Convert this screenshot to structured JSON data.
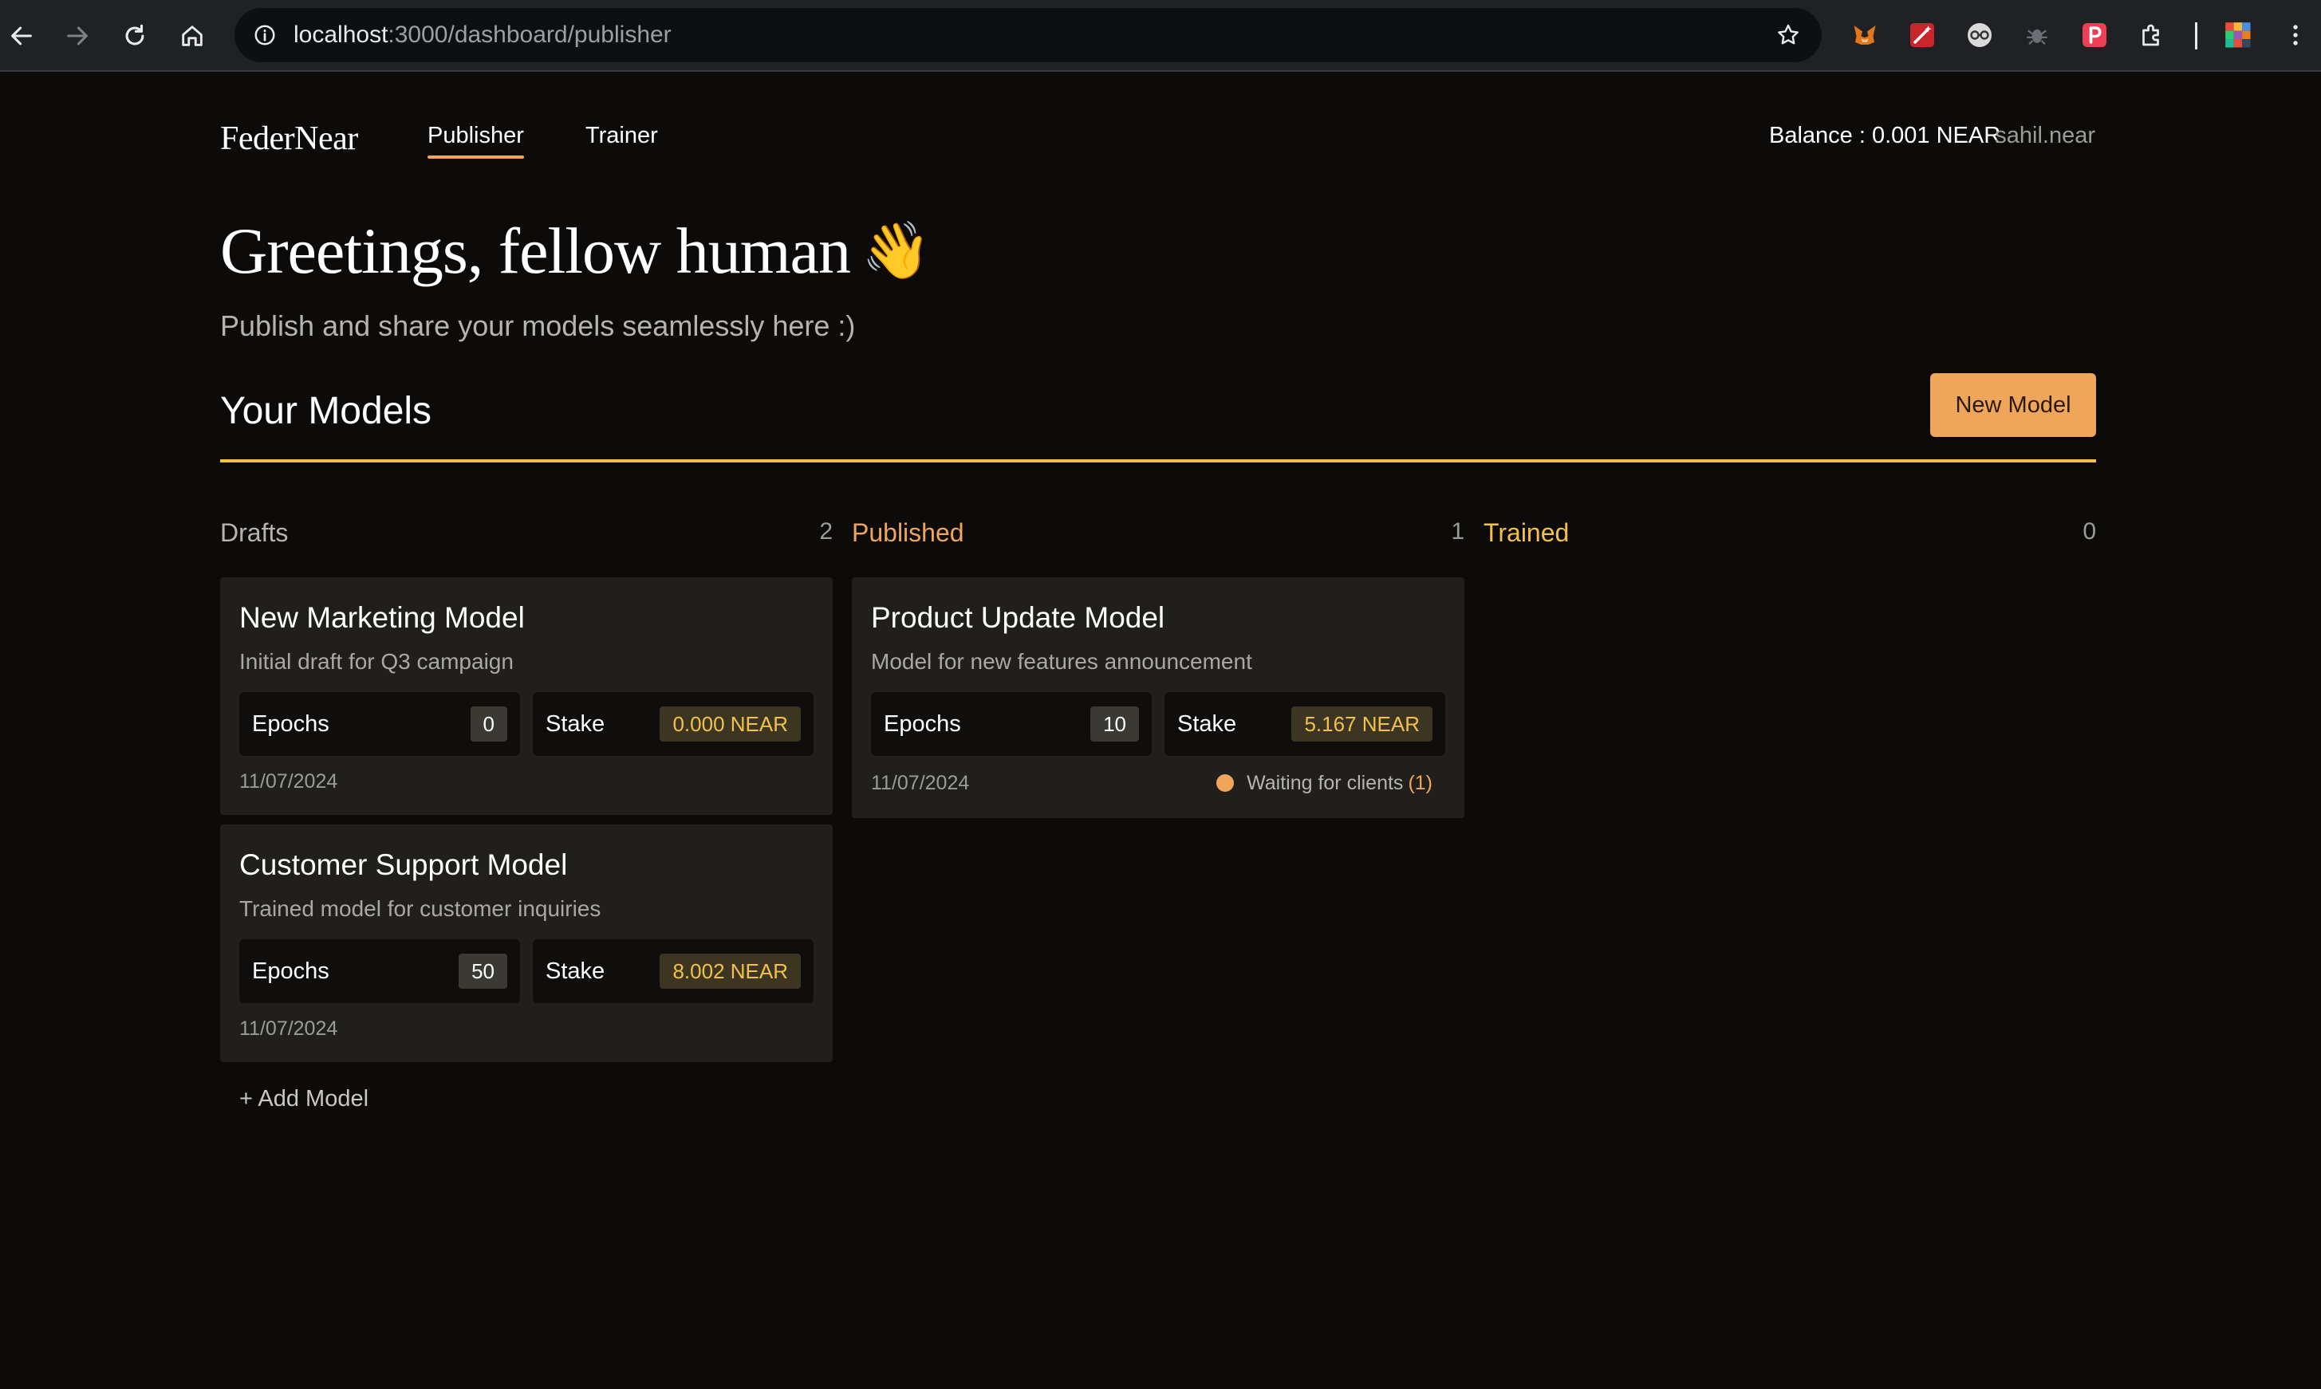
{
  "browser": {
    "url_host": "localhost",
    "url_rest": ":3000/dashboard/publisher"
  },
  "header": {
    "logo": "FederNear",
    "nav": [
      {
        "label": "Publisher",
        "active": true
      },
      {
        "label": "Trainer",
        "active": false
      }
    ],
    "balance": "Balance : 0.001 NEAR",
    "account": "sahil.near"
  },
  "hero": {
    "greeting": "Greetings, fellow human",
    "wave_emoji": "👋",
    "subtitle": "Publish and share your models seamlessly here :)"
  },
  "models": {
    "title": "Your Models",
    "new_button": "New Model",
    "add_model": "+ Add Model",
    "columns": [
      {
        "title": "Drafts",
        "count": "2",
        "color": "#b5b4af",
        "cards": [
          {
            "title": "New Marketing Model",
            "description": "Initial draft for Q3 campaign",
            "epochs_label": "Epochs",
            "epochs": "0",
            "stake_label": "Stake",
            "stake": "0.000 NEAR",
            "date": "11/07/2024"
          },
          {
            "title": "Customer Support Model",
            "description": "Trained model for customer inquiries",
            "epochs_label": "Epochs",
            "epochs": "50",
            "stake_label": "Stake",
            "stake": "8.002 NEAR",
            "date": "11/07/2024"
          }
        ]
      },
      {
        "title": "Published",
        "count": "1",
        "color": "#f0a65a",
        "cards": [
          {
            "title": "Product Update Model",
            "description": "Model for new features announcement",
            "epochs_label": "Epochs",
            "epochs": "10",
            "stake_label": "Stake",
            "stake": "5.167 NEAR",
            "date": "11/07/2024",
            "status": "Waiting for clients",
            "status_count": "(1)"
          }
        ]
      },
      {
        "title": "Trained",
        "count": "0",
        "color": "#f2c14a",
        "cards": []
      }
    ]
  },
  "colors": {
    "accent_orange": "#f0a65a",
    "accent_yellow": "#f2c14a",
    "background": "#0c0b09",
    "card": "#201f1b"
  }
}
